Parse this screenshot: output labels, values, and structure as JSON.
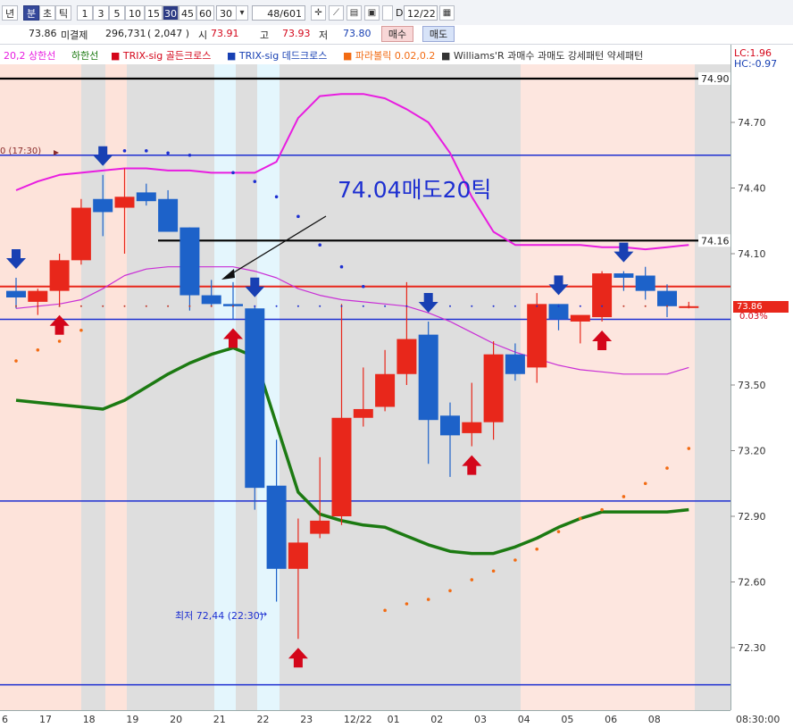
{
  "toolbar": {
    "period_types": [
      "년",
      "분",
      "초",
      "틱"
    ],
    "period_selected": "분",
    "intervals": [
      "1",
      "3",
      "5",
      "10",
      "15",
      "30",
      "45",
      "60"
    ],
    "interval_selected": "30",
    "interval_dropdown_value": "30",
    "count_field": "48/601",
    "d_checkbox_label": "D",
    "date_field": "12/22",
    "icons": [
      "crosshair-icon",
      "draw-tool-icon",
      "chart-type-icon",
      "save-icon",
      "copy-icon",
      "calendar-icon"
    ]
  },
  "quote": {
    "last": "73.86",
    "oi_label": "미결제",
    "oi_value": "296,731",
    "oi_change": "( 2,047 )",
    "open_label": "시",
    "open_value": "73.91",
    "high_label": "고",
    "high_value": "73.93",
    "low_label": "저",
    "low_value": "73.80",
    "buy_label": "매수",
    "sell_label": "매도"
  },
  "legend": {
    "upper_band": "20,2 상한선",
    "lower_band": "하한선",
    "trix_golden": "TRIX-sig 골든크로스",
    "trix_dead": "TRIX-sig 데드크로스",
    "parabolic": "파라볼릭 0.02,0.2",
    "williams": "Williams'R 과매수 과매도 강세패턴  약세패턴",
    "lc": "LC:1.96",
    "hc": "HC:-0.97"
  },
  "annotations": {
    "sell_note": "74.04매도20틱",
    "low_note": "최저 72,44 (22:30)",
    "left_cut_note": "0 (17:30)"
  },
  "price_tag": {
    "value": "73.86",
    "change": "0.03%"
  },
  "colors": {
    "bull": "#e8271b",
    "bear": "#1d62c9",
    "upper_band": "#e81ce0",
    "middle_band": "#c92ed6",
    "lower_band": "#1c7a12",
    "sar": "#f26b13",
    "signal_up": "#d4061a",
    "signal_down": "#1840b3",
    "bg_salmon": "#fde3da",
    "bg_gray": "#dedede",
    "bg_cyan": "#e4f6fd",
    "bg_pink": "#fde6df"
  },
  "chart_data": {
    "type": "candlestick",
    "ylim": [
      72.13,
      75.03
    ],
    "y_ticks": [
      74.7,
      74.4,
      74.1,
      73.5,
      73.2,
      72.9,
      72.6,
      72.3
    ],
    "marked_levels": [
      74.9,
      74.16
    ],
    "x_labels": [
      "6",
      "17",
      "18",
      "19",
      "20",
      "21",
      "22",
      "23",
      "12/22",
      "01",
      "02",
      "03",
      "04",
      "05",
      "06",
      "08"
    ],
    "x_corner_label": "08:30:00",
    "candles": [
      {
        "o": 73.93,
        "h": 73.99,
        "l": 73.85,
        "c": 73.9
      },
      {
        "o": 73.88,
        "h": 73.94,
        "l": 73.82,
        "c": 73.93
      },
      {
        "o": 73.93,
        "h": 74.1,
        "l": 73.86,
        "c": 74.07
      },
      {
        "o": 74.07,
        "h": 74.35,
        "l": 74.05,
        "c": 74.31
      },
      {
        "o": 74.35,
        "h": 74.46,
        "l": 74.18,
        "c": 74.29
      },
      {
        "o": 74.31,
        "h": 74.49,
        "l": 74.1,
        "c": 74.36
      },
      {
        "o": 74.38,
        "h": 74.42,
        "l": 74.32,
        "c": 74.34
      },
      {
        "o": 74.35,
        "h": 74.39,
        "l": 74.21,
        "c": 74.2
      },
      {
        "o": 74.22,
        "h": 74.22,
        "l": 73.84,
        "c": 73.91
      },
      {
        "o": 73.91,
        "h": 73.98,
        "l": 73.86,
        "c": 73.87
      },
      {
        "o": 73.87,
        "h": 73.97,
        "l": 73.8,
        "c": 73.86
      },
      {
        "o": 73.85,
        "h": 73.86,
        "l": 72.93,
        "c": 73.03
      },
      {
        "o": 73.04,
        "h": 73.25,
        "l": 72.51,
        "c": 72.66
      },
      {
        "o": 72.66,
        "h": 72.89,
        "l": 72.34,
        "c": 72.78
      },
      {
        "o": 72.82,
        "h": 73.17,
        "l": 72.8,
        "c": 72.88
      },
      {
        "o": 72.9,
        "h": 73.87,
        "l": 72.86,
        "c": 73.35
      },
      {
        "o": 73.35,
        "h": 73.58,
        "l": 73.31,
        "c": 73.39
      },
      {
        "o": 73.4,
        "h": 73.66,
        "l": 73.38,
        "c": 73.55
      },
      {
        "o": 73.55,
        "h": 73.97,
        "l": 73.5,
        "c": 73.71
      },
      {
        "o": 73.73,
        "h": 73.79,
        "l": 73.14,
        "c": 73.34
      },
      {
        "o": 73.36,
        "h": 73.42,
        "l": 73.08,
        "c": 73.27
      },
      {
        "o": 73.28,
        "h": 73.51,
        "l": 73.22,
        "c": 73.33
      },
      {
        "o": 73.33,
        "h": 73.7,
        "l": 73.25,
        "c": 73.64
      },
      {
        "o": 73.64,
        "h": 73.69,
        "l": 73.52,
        "c": 73.55
      },
      {
        "o": 73.58,
        "h": 73.92,
        "l": 73.51,
        "c": 73.87
      },
      {
        "o": 73.87,
        "h": 73.87,
        "l": 73.75,
        "c": 73.8
      },
      {
        "o": 73.79,
        "h": 73.81,
        "l": 73.69,
        "c": 73.82
      },
      {
        "o": 73.81,
        "h": 74.02,
        "l": 73.79,
        "c": 74.01
      },
      {
        "o": 74.01,
        "h": 74.02,
        "l": 73.93,
        "c": 73.99
      },
      {
        "o": 74.0,
        "h": 74.04,
        "l": 73.89,
        "c": 73.93
      },
      {
        "o": 73.93,
        "h": 73.96,
        "l": 73.81,
        "c": 73.86
      },
      {
        "o": 73.86,
        "h": 73.88,
        "l": 73.85,
        "c": 73.86
      }
    ],
    "upper_band": [
      74.39,
      74.43,
      74.46,
      74.47,
      74.48,
      74.49,
      74.49,
      74.48,
      74.48,
      74.47,
      74.47,
      74.47,
      74.52,
      74.72,
      74.82,
      74.83,
      74.83,
      74.81,
      74.76,
      74.7,
      74.56,
      74.36,
      74.2,
      74.14,
      74.14,
      74.14,
      74.14,
      74.13,
      74.13,
      74.12,
      74.13,
      74.14
    ],
    "middle_band": [
      73.85,
      73.86,
      73.87,
      73.89,
      73.94,
      74.0,
      74.03,
      74.04,
      74.04,
      74.04,
      74.04,
      74.02,
      73.99,
      73.94,
      73.91,
      73.89,
      73.88,
      73.87,
      73.86,
      73.83,
      73.79,
      73.74,
      73.69,
      73.65,
      73.62,
      73.59,
      73.57,
      73.56,
      73.55,
      73.55,
      73.55,
      73.58
    ],
    "lower_band": [
      73.43,
      73.42,
      73.41,
      73.4,
      73.39,
      73.43,
      73.49,
      73.55,
      73.6,
      73.64,
      73.67,
      73.63,
      73.32,
      73.01,
      72.91,
      72.88,
      72.86,
      72.85,
      72.81,
      72.77,
      72.74,
      72.73,
      72.73,
      72.76,
      72.8,
      72.85,
      72.89,
      72.92,
      72.92,
      72.92,
      72.92,
      72.93
    ],
    "sar": [
      73.61,
      73.66,
      73.7,
      73.75,
      null,
      74.57,
      74.57,
      74.56,
      74.55,
      null,
      74.47,
      74.43,
      74.36,
      74.27,
      74.14,
      74.04,
      73.95,
      72.47,
      72.5,
      72.52,
      72.56,
      72.61,
      72.65,
      72.7,
      72.75,
      72.83,
      72.89,
      72.93,
      72.99,
      73.05,
      73.12,
      73.21
    ],
    "sar_below": [
      true,
      true,
      true,
      true,
      false,
      false,
      false,
      false,
      false,
      false,
      false,
      false,
      false,
      false,
      false,
      false,
      false,
      true,
      true,
      true,
      true,
      true,
      true,
      true,
      true,
      true,
      true,
      true,
      true,
      true,
      true,
      true
    ],
    "signals_up": [
      2,
      10,
      13,
      21,
      27
    ],
    "signals_down": [
      0,
      4,
      11,
      19,
      25,
      28
    ],
    "lines": [
      {
        "value": 74.9,
        "color": "#000000"
      },
      {
        "value": 74.16,
        "color": "#000000"
      },
      {
        "value": 73.95,
        "color": "#e8271b"
      },
      {
        "value": 74.55,
        "color": "#1d2fd1"
      },
      {
        "value": 73.8,
        "color": "#1d2fd1"
      },
      {
        "value": 72.97,
        "color": "#1d2fd1"
      },
      {
        "value": 72.13,
        "color": "#1d2fd1"
      }
    ]
  }
}
